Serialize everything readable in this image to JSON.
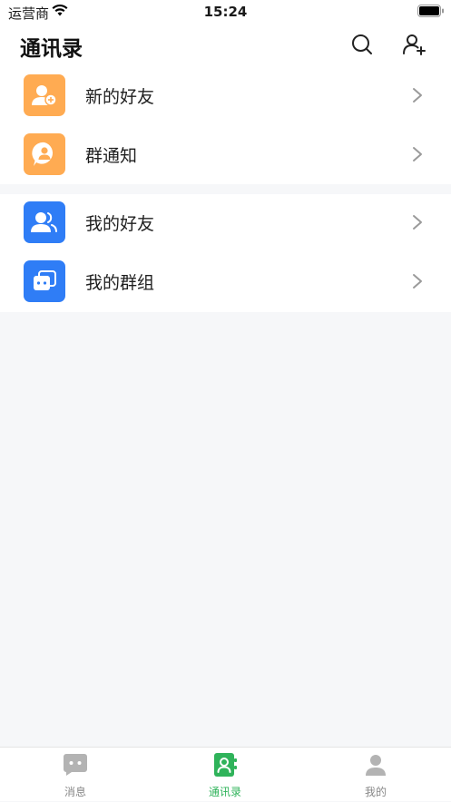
{
  "status_bar": {
    "carrier": "运营商",
    "time": "15:24"
  },
  "header": {
    "title": "通讯录"
  },
  "groups": [
    {
      "items": [
        {
          "label": "新的好友",
          "icon": "add-friend-icon"
        },
        {
          "label": "群通知",
          "icon": "group-notice-icon"
        }
      ]
    },
    {
      "items": [
        {
          "label": "我的好友",
          "icon": "friends-icon"
        },
        {
          "label": "我的群组",
          "icon": "groups-icon"
        }
      ]
    }
  ],
  "tabbar": {
    "tabs": [
      {
        "label": "消息",
        "icon": "chat-icon"
      },
      {
        "label": "通讯录",
        "icon": "contacts-icon",
        "active": true
      },
      {
        "label": "我的",
        "icon": "profile-icon"
      }
    ]
  },
  "colors": {
    "accent_green": "#2fb35a",
    "orange": "#ffab52",
    "blue": "#2f7df6"
  }
}
